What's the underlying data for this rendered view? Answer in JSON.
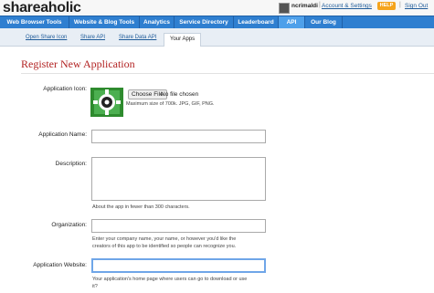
{
  "header": {
    "logo": "shareaholic",
    "username": "ncrimaldi",
    "account_link": "Account & Settings",
    "help_label": "HELP",
    "signout_link": "Sign Out",
    "separator": "|"
  },
  "nav": {
    "items": [
      {
        "label": "Web Browser Tools"
      },
      {
        "label": "Website & Blog Tools"
      },
      {
        "label": "Analytics"
      },
      {
        "label": "Service Directory"
      },
      {
        "label": "Leaderboard"
      },
      {
        "label": "API",
        "active": true
      },
      {
        "label": "Our Blog"
      }
    ]
  },
  "subnav": {
    "items": [
      {
        "label": "Open Share Icon"
      },
      {
        "label": "Share API"
      },
      {
        "label": "Share Data API"
      },
      {
        "label": "Your Apps",
        "active": true
      }
    ]
  },
  "page": {
    "title": "Register New Application"
  },
  "form": {
    "icon": {
      "label": "Application Icon:",
      "button": "Choose File",
      "no_file": "No file chosen",
      "hint": "Maximum size of 700k. JPG, GIF, PNG."
    },
    "name": {
      "label": "Application Name:",
      "value": ""
    },
    "description": {
      "label": "Description:",
      "value": "",
      "hint": "About the app in fewer than 300 characters."
    },
    "organization": {
      "label": "Organization:",
      "value": "",
      "hint_line1": "Enter your company name, your name, or however you'd like the",
      "hint_line2": "creators of this app to be identified so people can recognize you."
    },
    "website": {
      "label": "Application Website:",
      "value": "",
      "hint_line1": "Your application's home page where users can go to download or use",
      "hint_line2": "it?"
    }
  },
  "colors": {
    "nav_bg": "#2f7fd0",
    "nav_active": "#4ea0ea",
    "heading": "#b22222",
    "help": "#f5a41d",
    "link": "#1f5b99"
  }
}
